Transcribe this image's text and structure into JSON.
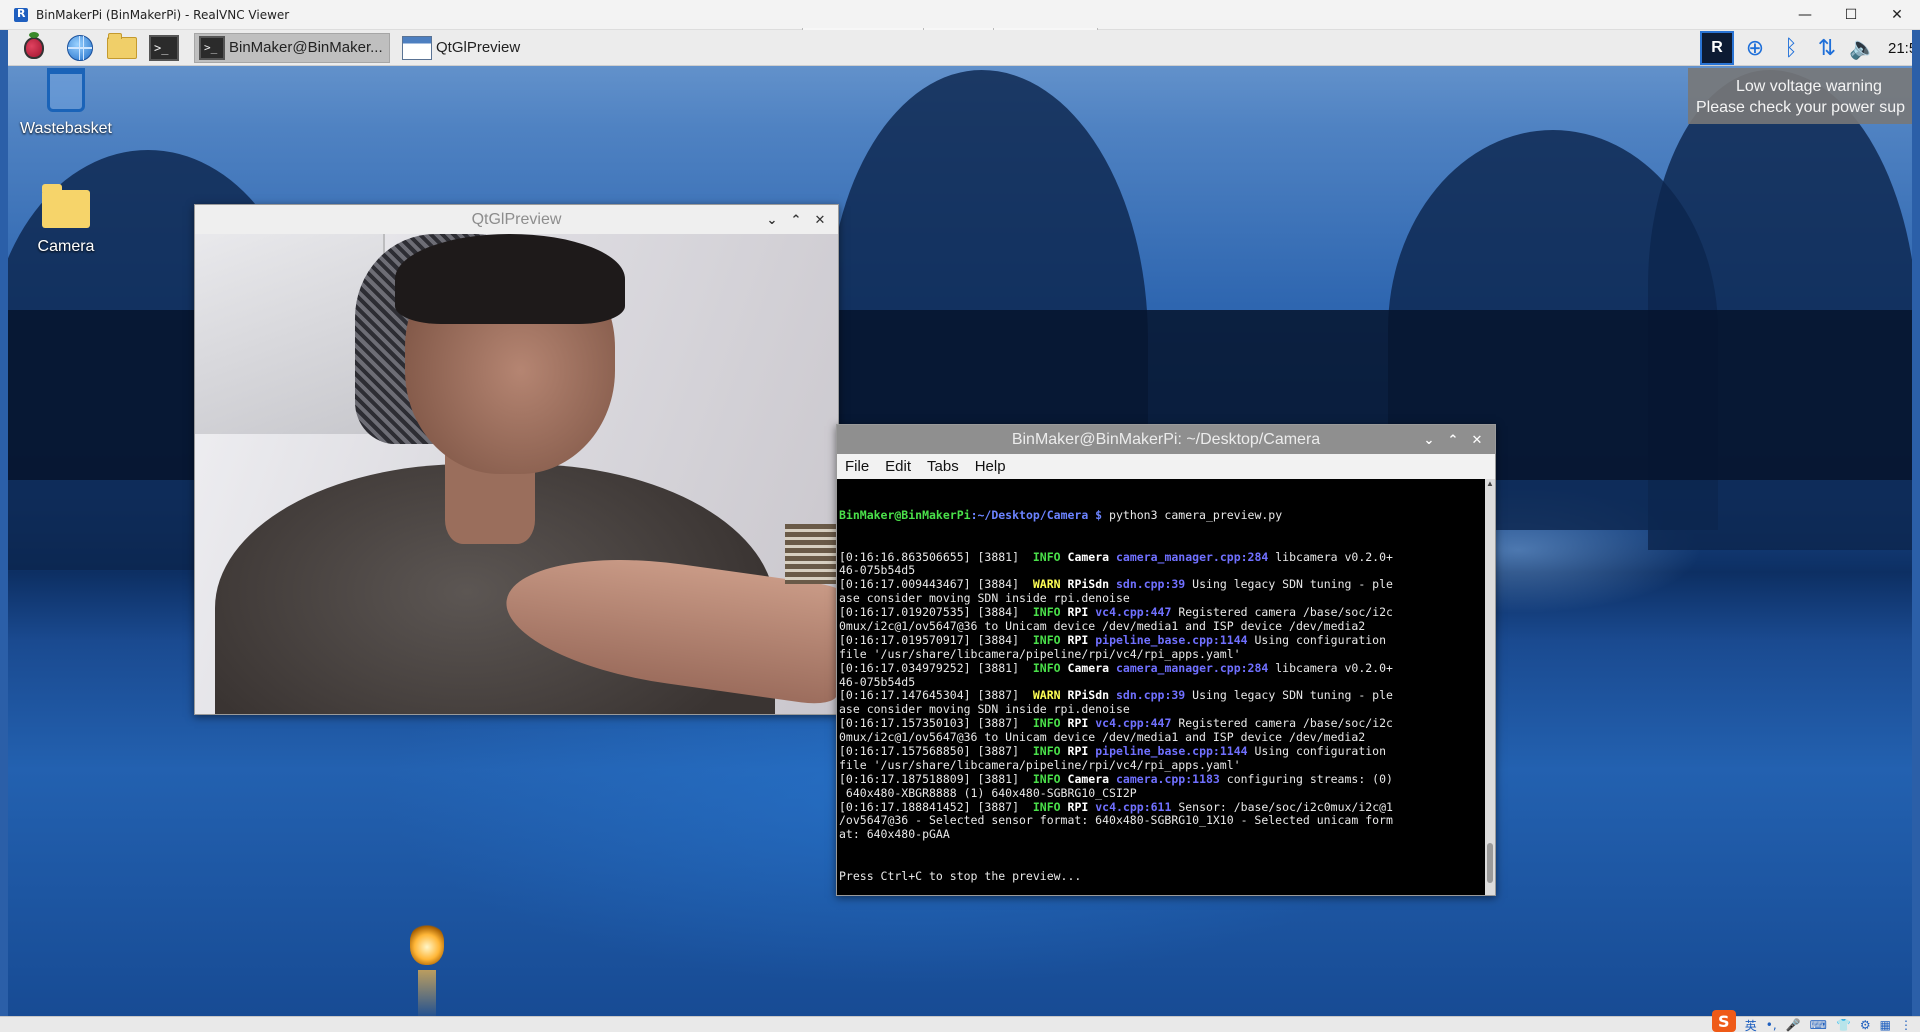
{
  "vnc": {
    "title": "BinMakerPi (BinMakerPi) - RealVNC Viewer",
    "controls": {
      "minimize": "—",
      "maximize": "☐",
      "close": "✕"
    }
  },
  "taskbar": {
    "launchers": [
      {
        "name": "raspberry-menu-icon"
      },
      {
        "name": "web-browser-icon"
      },
      {
        "name": "file-manager-icon"
      },
      {
        "name": "terminal-icon",
        "glyph": ">_"
      }
    ],
    "tasks": [
      {
        "label": "BinMaker@BinMaker...",
        "active": true
      },
      {
        "label": "QtGlPreview",
        "active": false
      }
    ],
    "tray": {
      "vnc_label": "R",
      "clock": "21:5"
    }
  },
  "tooltip": {
    "line1": "Low voltage warning",
    "line2": "Please check your power sup"
  },
  "desktop_icons": [
    {
      "label": "Wastebasket"
    },
    {
      "label": "Camera"
    }
  ],
  "qt_window": {
    "title": "QtGlPreview",
    "controls": {
      "minimize": "⌄",
      "maximize": "⌃",
      "close": "✕"
    }
  },
  "terminal_window": {
    "title": "BinMaker@BinMakerPi: ~/Desktop/Camera",
    "controls": {
      "minimize": "⌄",
      "maximize": "⌃",
      "close": "✕"
    },
    "menu": [
      "File",
      "Edit",
      "Tabs",
      "Help"
    ],
    "prompt_user": "BinMaker@BinMakerPi",
    "prompt_path": ":~/Desktop/Camera $",
    "command": " python3 camera_preview.py",
    "log": [
      {
        "ts": "[0:16:16.863506655] [3881]",
        "level": "INFO",
        "comp": "Camera",
        "src": "camera_manager.cpp:284",
        "msg": " libcamera v0.2.0+",
        "cont": "46-075b54d5"
      },
      {
        "ts": "[0:16:17.009443467] [3884]",
        "level": "WARN",
        "comp": "RPiSdn",
        "src": "sdn.cpp:39",
        "msg": " Using legacy SDN tuning - ple",
        "cont": "ase consider moving SDN inside rpi.denoise"
      },
      {
        "ts": "[0:16:17.019207535] [3884]",
        "level": "INFO",
        "comp": "RPI",
        "src": "vc4.cpp:447",
        "msg": " Registered camera /base/soc/i2c",
        "cont": "0mux/i2c@1/ov5647@36 to Unicam device /dev/media1 and ISP device /dev/media2"
      },
      {
        "ts": "[0:16:17.019570917] [3884]",
        "level": "INFO",
        "comp": "RPI",
        "src": "pipeline_base.cpp:1144",
        "msg": " Using configuration",
        "cont": "file '/usr/share/libcamera/pipeline/rpi/vc4/rpi_apps.yaml'"
      },
      {
        "ts": "[0:16:17.034979252] [3881]",
        "level": "INFO",
        "comp": "Camera",
        "src": "camera_manager.cpp:284",
        "msg": " libcamera v0.2.0+",
        "cont": "46-075b54d5"
      },
      {
        "ts": "[0:16:17.147645304] [3887]",
        "level": "WARN",
        "comp": "RPiSdn",
        "src": "sdn.cpp:39",
        "msg": " Using legacy SDN tuning - ple",
        "cont": "ase consider moving SDN inside rpi.denoise"
      },
      {
        "ts": "[0:16:17.157350103] [3887]",
        "level": "INFO",
        "comp": "RPI",
        "src": "vc4.cpp:447",
        "msg": " Registered camera /base/soc/i2c",
        "cont": "0mux/i2c@1/ov5647@36 to Unicam device /dev/media1 and ISP device /dev/media2"
      },
      {
        "ts": "[0:16:17.157568850] [3887]",
        "level": "INFO",
        "comp": "RPI",
        "src": "pipeline_base.cpp:1144",
        "msg": " Using configuration",
        "cont": "file '/usr/share/libcamera/pipeline/rpi/vc4/rpi_apps.yaml'"
      },
      {
        "ts": "[0:16:17.187518809] [3881]",
        "level": "INFO",
        "comp": "Camera",
        "src": "camera.cpp:1183",
        "msg": " configuring streams: (0)",
        "cont": " 640x480-XBGR8888 (1) 640x480-SGBRG10_CSI2P"
      },
      {
        "ts": "[0:16:17.188841452] [3887]",
        "level": "INFO",
        "comp": "RPI",
        "src": "vc4.cpp:611",
        "msg": " Sensor: /base/soc/i2c0mux/i2c@1",
        "cont": "/ov5647@36 - Selected sensor format: 640x480-SGBRG10_1X10 - Selected unicam form",
        "cont2": "at: 640x480-pGAA"
      }
    ],
    "footer": "Press Ctrl+C to stop the preview..."
  },
  "ime": {
    "logo": "S",
    "lang": "英",
    "items": [
      "•,",
      "🎤",
      "⌨",
      "👕",
      "⚙",
      "▦",
      "⋮"
    ]
  }
}
